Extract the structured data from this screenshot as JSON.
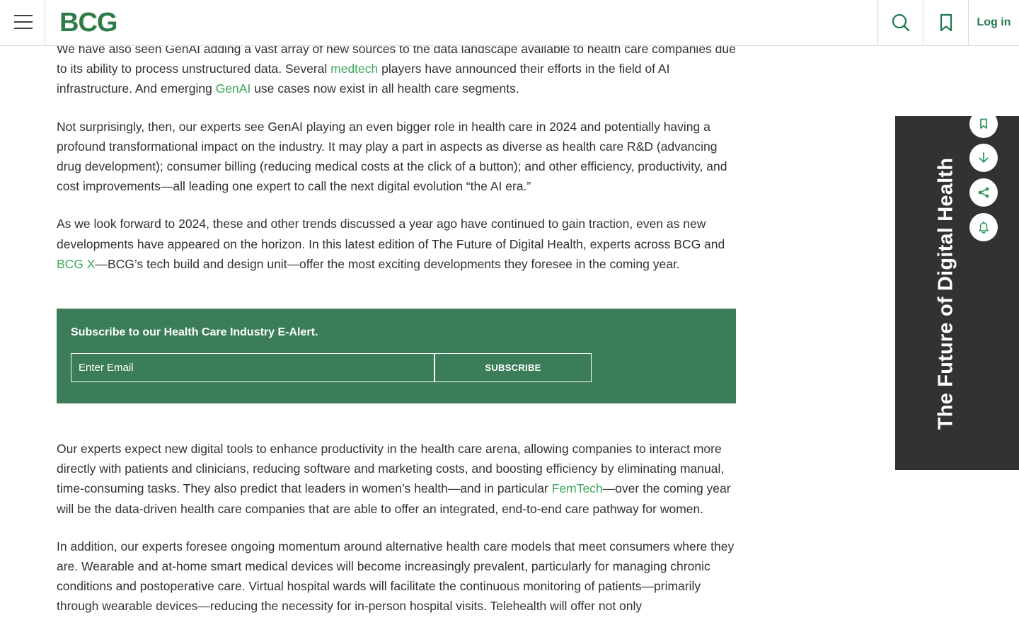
{
  "header": {
    "logo": "BCG",
    "login_label": "Log in"
  },
  "article": {
    "p1": {
      "t1": "We have also seen GenAI adding a vast array of new sources to the data landscape available to health care companies due to its ability to process unstructured data. Several ",
      "link1": "medtech",
      "t2": " players have announced their efforts in the field of AI infrastructure. And emerging ",
      "link2": "GenAI",
      "t3": " use cases now exist in all health care segments."
    },
    "p2": "Not surprisingly, then, our experts see GenAI playing an even bigger role in health care in 2024 and potentially having a profound transformational impact on the industry. It may play a part in aspects as diverse as health care R&D (advancing drug development); consumer billing (reducing medical costs at the click of a button); and other efficiency, productivity, and cost improvements—all leading one expert to call the next digital evolution “the AI era.”",
    "p3": {
      "t1": "As we look forward to 2024, these and other trends discussed a year ago have continued to gain traction, even as new developments have appeared on the horizon. In this latest edition of The Future of Digital Health, experts across BCG and ",
      "link1": "BCG X",
      "t2": "—BCG’s tech build and design unit—offer the most exciting developments they foresee in the coming year."
    },
    "p4": {
      "t1": "Our experts expect new digital tools to enhance productivity in the health care arena, allowing companies to interact more directly with patients and clinicians, reducing software and marketing costs, and boosting efficiency by eliminating manual, time-consuming tasks. They also predict that leaders in women’s health—and in particular ",
      "link1": "FemTech",
      "t2": "—over the coming year will be the data-driven health care companies that are able to offer an integrated, end-to-end care pathway for women."
    },
    "p5": "In addition, our experts foresee ongoing momentum around alternative health care models that meet consumers where they are. Wearable and at-home smart medical devices will become increasingly prevalent, particularly for managing chronic conditions and postoperative care. Virtual hospital wards will facilitate the continuous monitoring of patients—primarily through wearable devices—reducing the necessity for in-person hospital visits. Telehealth will offer not only"
  },
  "subscribe": {
    "title": "Subscribe to our Health Care Industry E-Alert.",
    "email_placeholder": "Enter Email",
    "button_label": "SUBSCRIBE"
  },
  "side_banner": {
    "title": "The Future of Digital Health",
    "actions": [
      "bookmark-icon",
      "download-icon",
      "share-icon",
      "bell-icon"
    ]
  },
  "colors": {
    "brand_green": "#2e7d48",
    "link_green": "#3ea85f",
    "subscribe_bg": "#3b7d58",
    "banner_bg": "#323232"
  }
}
